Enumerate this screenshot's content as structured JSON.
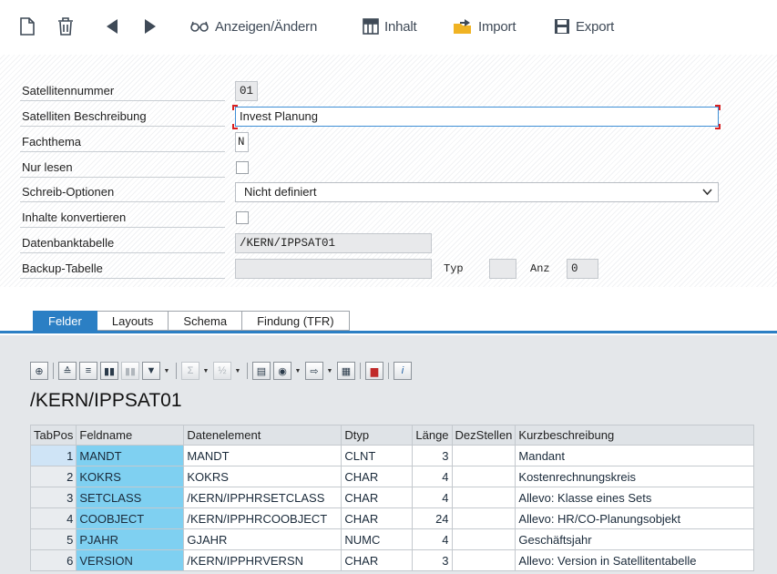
{
  "toolbar": {
    "display_change_label": "Anzeigen/Ändern",
    "content_label": "Inhalt",
    "import_label": "Import",
    "export_label": "Export"
  },
  "form": {
    "satellite_number": {
      "label": "Satellitennummer",
      "value": "01"
    },
    "satellite_description": {
      "label": "Satelliten Beschreibung",
      "value": "Invest Planung"
    },
    "subject": {
      "label": "Fachthema",
      "value": "N"
    },
    "read_only": {
      "label": "Nur lesen",
      "checked": false
    },
    "write_options": {
      "label": "Schreib-Optionen",
      "value": "Nicht definiert"
    },
    "convert_contents": {
      "label": "Inhalte konvertieren",
      "checked": false
    },
    "db_table": {
      "label": "Datenbanktabelle",
      "value": "/KERN/IPPSAT01"
    },
    "backup_table": {
      "label": "Backup-Tabelle",
      "value": ""
    },
    "typ_label": "Typ",
    "typ_value": "",
    "anz_label": "Anz",
    "anz_value": "0"
  },
  "tabs": [
    {
      "label": "Felder",
      "active": true
    },
    {
      "label": "Layouts",
      "active": false
    },
    {
      "label": "Schema",
      "active": false
    },
    {
      "label": "Findung (TFR)",
      "active": false
    }
  ],
  "alv": {
    "title": "/KERN/IPPSAT01",
    "columns": [
      "TabPos",
      "Feldname",
      "Datenelement",
      "Dtyp",
      "Länge",
      "DezStellen",
      "Kurzbeschreibung"
    ],
    "rows": [
      [
        "1",
        "MANDT",
        "MANDT",
        "CLNT",
        "3",
        "",
        "Mandant"
      ],
      [
        "2",
        "KOKRS",
        "KOKRS",
        "CHAR",
        "4",
        "",
        "Kostenrechnungskreis"
      ],
      [
        "3",
        "SETCLASS",
        "/KERN/IPPHRSETCLASS",
        "CHAR",
        "4",
        "",
        "Allevo: Klasse eines Sets"
      ],
      [
        "4",
        "COOBJECT",
        "/KERN/IPPHRCOOBJECT",
        "CHAR",
        "24",
        "",
        "Allevo: HR/CO-Planungsobjekt"
      ],
      [
        "5",
        "PJAHR",
        "GJAHR",
        "NUMC",
        "4",
        "",
        "Geschäftsjahr"
      ],
      [
        "6",
        "VERSION",
        "/KERN/IPPHRVERSN",
        "CHAR",
        "3",
        "",
        "Allevo: Version in Satellitentabelle"
      ]
    ]
  },
  "colors": {
    "accent": "#2b7fc4",
    "key_column": "#7fd0f1",
    "focus_marker": "#d92020"
  }
}
